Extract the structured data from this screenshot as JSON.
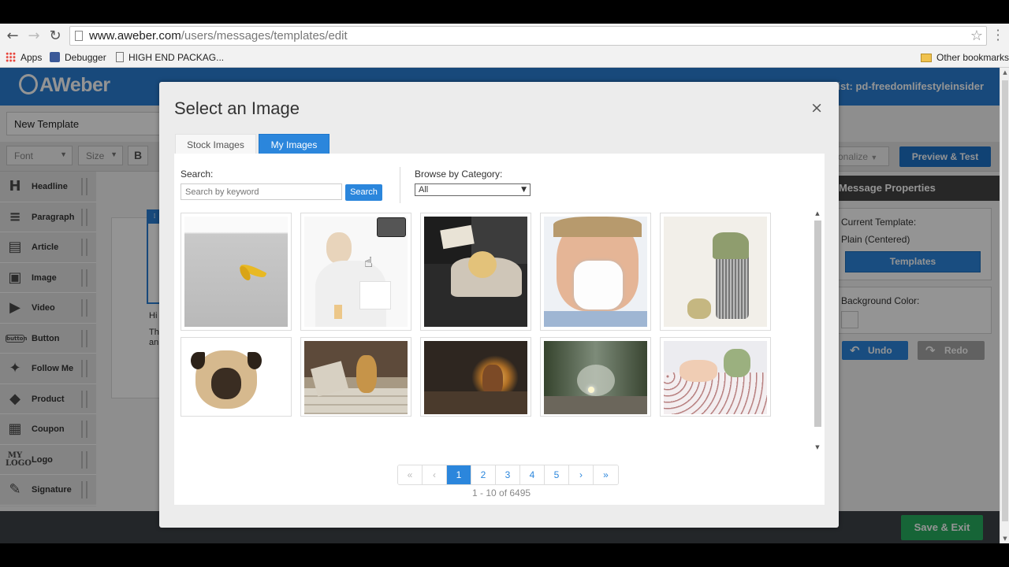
{
  "browser": {
    "url_host": "www.aweber.com",
    "url_path": "/users/messages/templates/edit",
    "bookmarks": [
      "Apps",
      "Debugger",
      "HIGH END PACKAG...",
      "Other bookmarks"
    ]
  },
  "app": {
    "logo_text": "AWeber",
    "list_label": "ent List: pd-freedomlifestyleinsider",
    "template_name": "New Template",
    "toolbar": {
      "font": "Font",
      "size": "Size",
      "bold": "B",
      "personalize": "onalize",
      "preview": "Preview & Test"
    },
    "sidebar": [
      {
        "label": "Headline",
        "icon": "headline-icon"
      },
      {
        "label": "Paragraph",
        "icon": "paragraph-icon"
      },
      {
        "label": "Article",
        "icon": "article-icon"
      },
      {
        "label": "Image",
        "icon": "image-icon"
      },
      {
        "label": "Video",
        "icon": "video-icon"
      },
      {
        "label": "Button",
        "icon": "button-icon"
      },
      {
        "label": "Follow Me",
        "icon": "twitter-icon"
      },
      {
        "label": "Product",
        "icon": "tag-icon"
      },
      {
        "label": "Coupon",
        "icon": "coupon-icon"
      },
      {
        "label": "Logo",
        "icon": "my-logo-icon"
      },
      {
        "label": "Signature",
        "icon": "pen-icon"
      }
    ],
    "canvas_text": [
      "Hi",
      "Th",
      "an"
    ],
    "props": {
      "header": "Message Properties",
      "current_template_label": "Current Template:",
      "current_template_value": "Plain (Centered)",
      "templates_button": "Templates",
      "background_label": "Background Color:",
      "undo": "Undo",
      "redo": "Redo"
    },
    "save_exit": "Save & Exit"
  },
  "modal": {
    "title": "Select an Image",
    "close": "×",
    "tabs": [
      "Stock Images",
      "My Images"
    ],
    "active_tab": "My Images",
    "search_label": "Search:",
    "search_placeholder": "Search by keyword",
    "search_button": "Search",
    "category_label": "Browse by Category:",
    "category_value": "All",
    "images": [
      "banana-peel-floor",
      "sick-woman-robe",
      "woman-therapist-couch",
      "man-sneezing-tissue",
      "money-trash-bin",
      "pug-dog",
      "dog-newspapers-steps",
      "child-dark-room",
      "motorcycle-foggy-road",
      "baby-crib-toy"
    ],
    "pagination": {
      "first": "«",
      "prev": "‹",
      "pages": [
        "1",
        "2",
        "3",
        "4",
        "5"
      ],
      "active_page": "1",
      "next": "›",
      "last": "»",
      "count_text": "1 - 10 of 6495"
    }
  }
}
